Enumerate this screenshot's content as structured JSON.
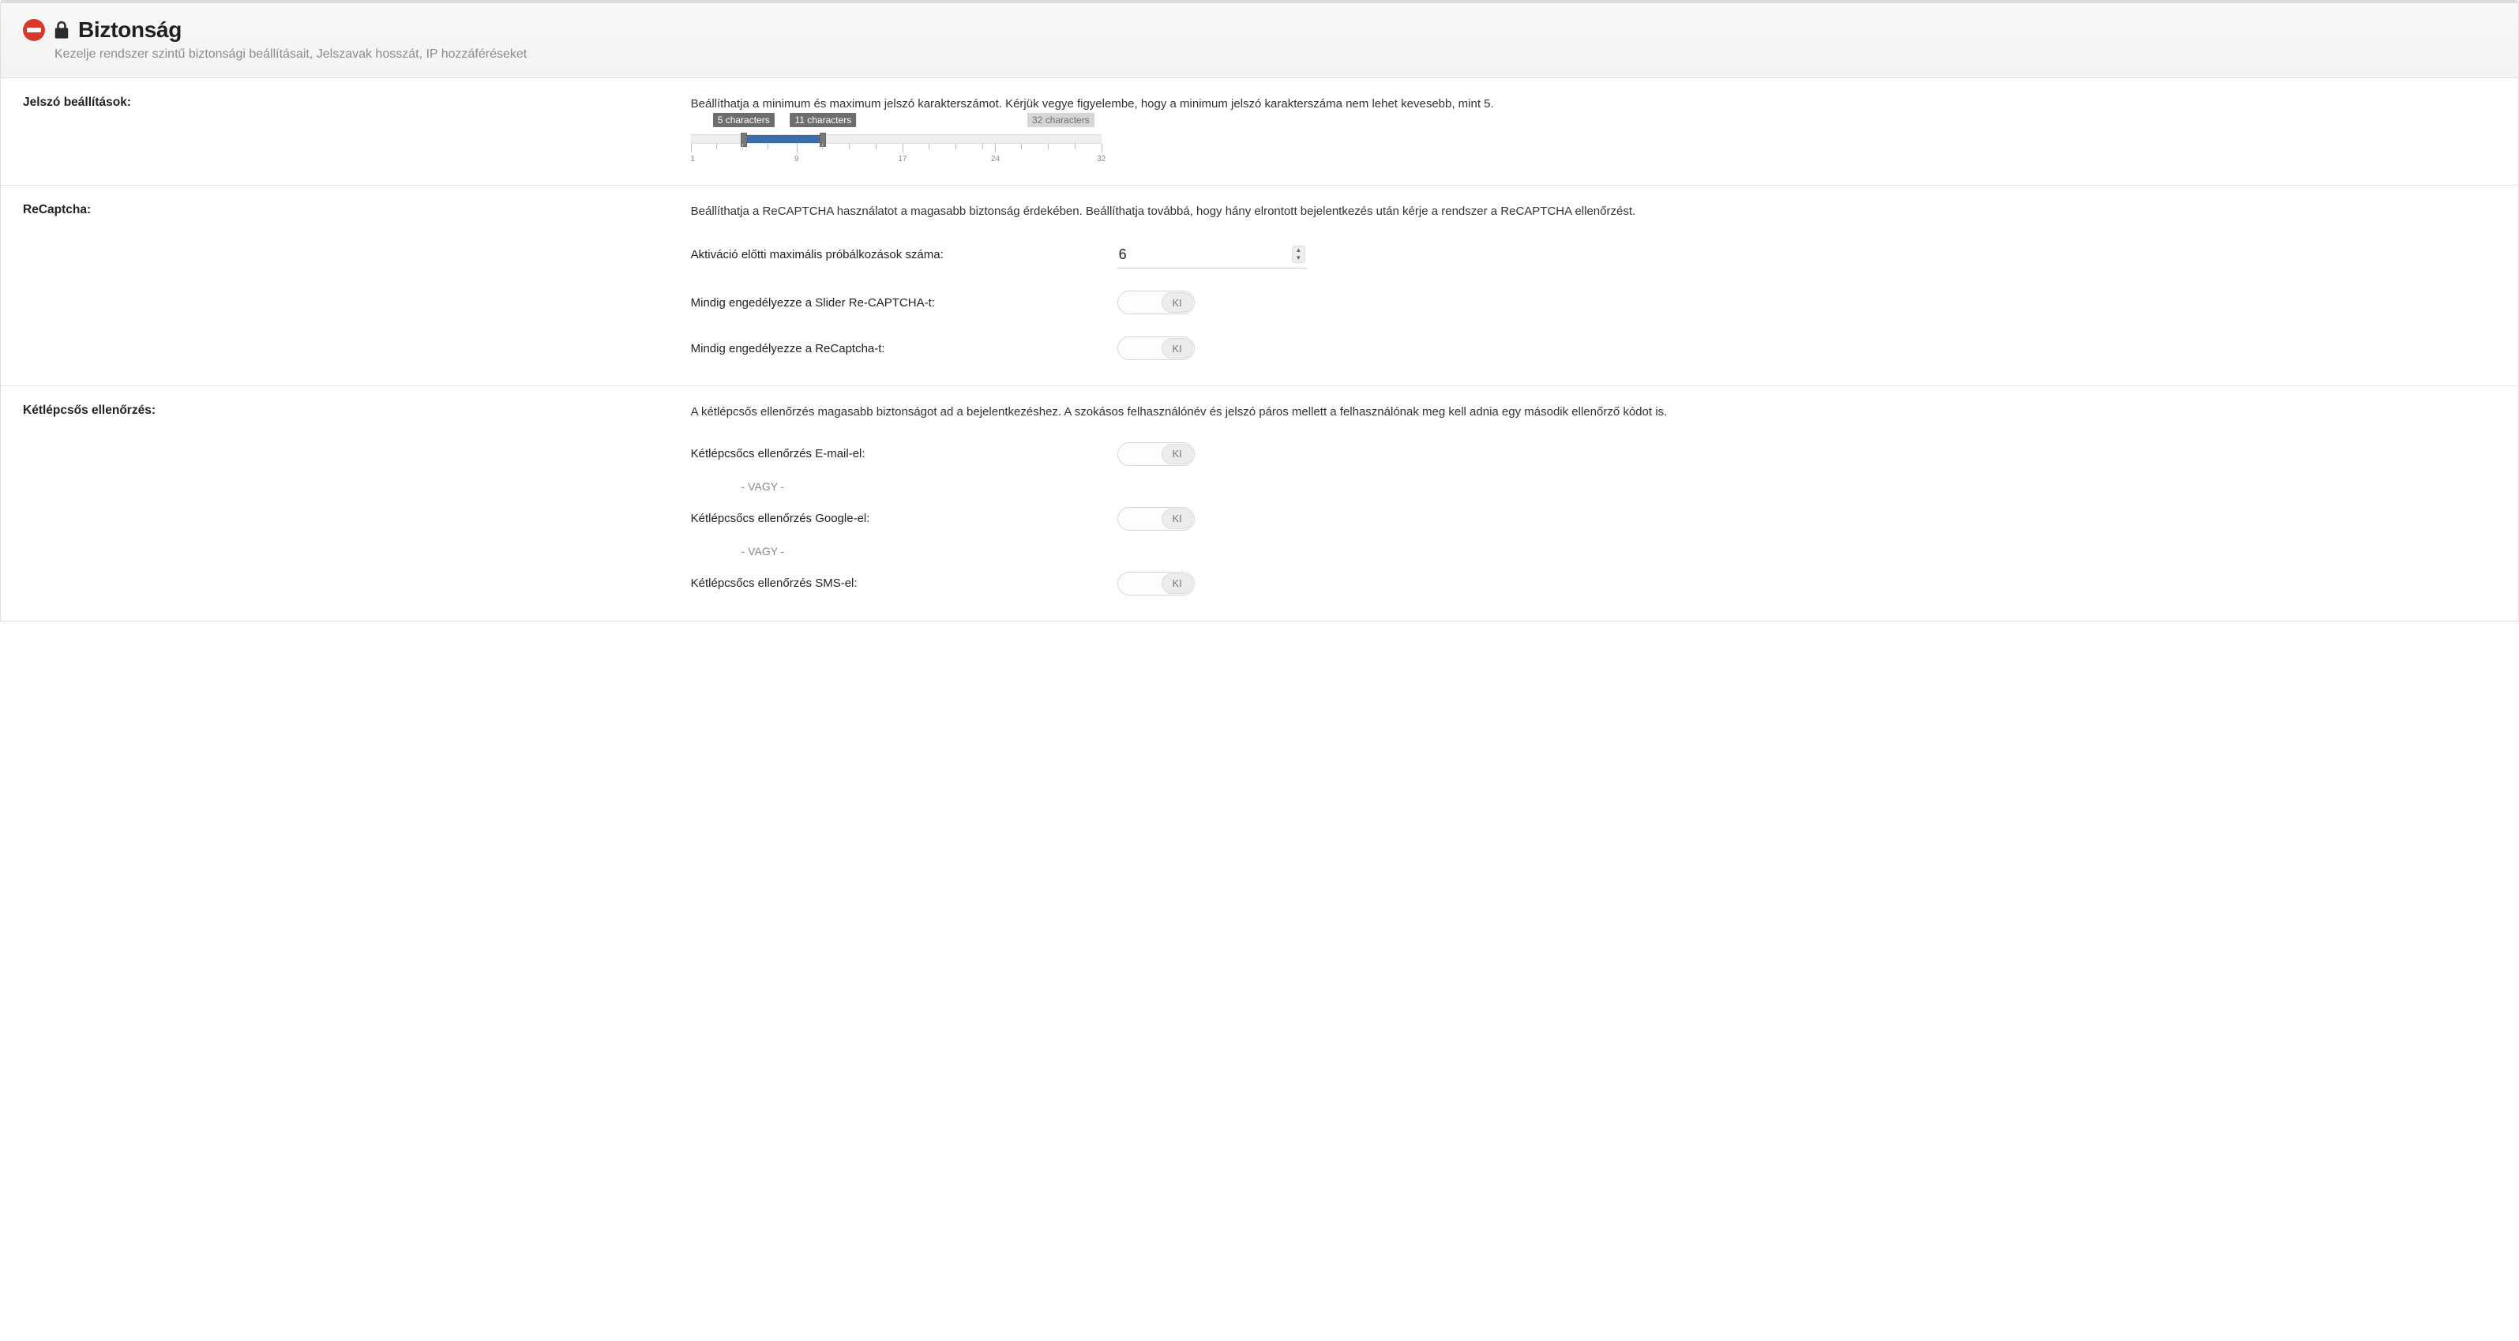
{
  "header": {
    "title": "Biztonság",
    "subtitle": "Kezelje rendszer szintű biztonsági beállításait, Jelszavak hosszát, IP hozzáféréseket"
  },
  "sections": {
    "password": {
      "label": "Jelszó beállítások:",
      "desc": "Beállíthatja a minimum és maximum jelszó karakterszámot. Kérjük vegye figyelembe, hogy a minimum jelszó karakterszáma nem lehet kevesebb, mint 5.",
      "slider": {
        "min": 1,
        "max": 32,
        "low": 5,
        "high": 11,
        "low_label": "5 characters",
        "high_label": "11 characters",
        "max_label": "32 characters",
        "ticks": [
          "1",
          "9",
          "17",
          "24",
          "32"
        ]
      }
    },
    "recaptcha": {
      "label": "ReCaptcha:",
      "desc": "Beállíthatja a ReCAPTCHA használatot a magasabb biztonság érdekében. Beállíthatja továbbá, hogy hány elrontott bejelentkezés után kérje a rendszer a ReCAPTCHA ellenőrzést.",
      "attempts_label": "Aktiváció előtti maximális próbálkozások száma:",
      "attempts_value": "6",
      "slider_captcha_label": "Mindig engedélyezze a Slider Re-CAPTCHA-t:",
      "slider_captcha_state": "KI",
      "recaptcha_label": "Mindig engedélyezze a ReCaptcha-t:",
      "recaptcha_state": "KI"
    },
    "two_step": {
      "label": "Kétlépcsős ellenőrzés:",
      "desc": "A kétlépcsős ellenőrzés magasabb biztonságot ad a bejelentkezéshez. A szokásos felhasználónév és jelszó páros mellett a felhasználónak meg kell adnia egy második ellenőrző kódot is.",
      "email_label": "Kétlépcsőcs ellenőrzés E-mail-el:",
      "email_state": "KI",
      "or": "- VAGY -",
      "google_label": "Kétlépcsőcs ellenőrzés Google-el:",
      "google_state": "KI",
      "sms_label": "Kétlépcsőcs ellenőrzés SMS-el:",
      "sms_state": "KI"
    }
  }
}
